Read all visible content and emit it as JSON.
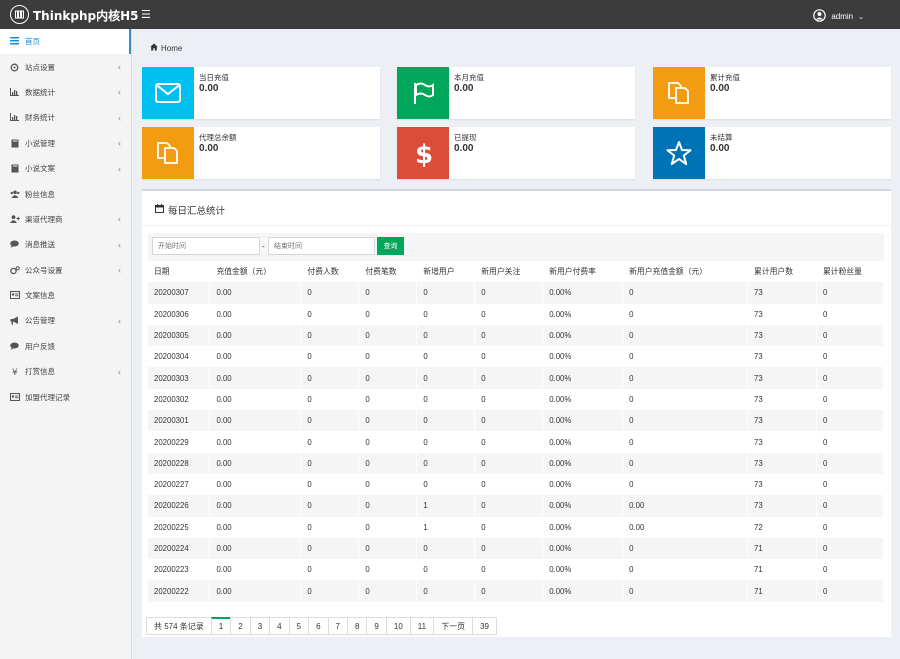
{
  "app": {
    "title": "Thinkphp内核H5",
    "user": "admin"
  },
  "sidebar": {
    "items": [
      {
        "label": "首页",
        "icon": "dashboard-icon",
        "chevron": false,
        "active": true
      },
      {
        "label": "站点设置",
        "icon": "settings-icon",
        "chevron": true
      },
      {
        "label": "数据统计",
        "icon": "bar-chart-icon",
        "chevron": true
      },
      {
        "label": "财务统计",
        "icon": "bar-chart-icon",
        "chevron": true
      },
      {
        "label": "小说管理",
        "icon": "book-icon",
        "chevron": true
      },
      {
        "label": "小说文案",
        "icon": "book-icon",
        "chevron": true
      },
      {
        "label": "粉丝信息",
        "icon": "users-icon",
        "chevron": false
      },
      {
        "label": "渠道代理商",
        "icon": "user-plus-icon",
        "chevron": true
      },
      {
        "label": "消息推送",
        "icon": "comments-icon",
        "chevron": true
      },
      {
        "label": "公众号设置",
        "icon": "cogs-icon",
        "chevron": true
      },
      {
        "label": "文案信息",
        "icon": "id-card-icon",
        "chevron": false
      },
      {
        "label": "公告管理",
        "icon": "bullhorn-icon",
        "chevron": true
      },
      {
        "label": "用户反馈",
        "icon": "comment-icon",
        "chevron": false
      },
      {
        "label": "打赏信息",
        "icon": "yen-icon",
        "chevron": true
      },
      {
        "label": "加盟代理记录",
        "icon": "id-card-icon",
        "chevron": false
      }
    ]
  },
  "breadcrumb": {
    "home": "Home"
  },
  "stats": [
    {
      "label": "当日充值",
      "value": "0.00",
      "color": "#00c0ef",
      "icon": "envelope-icon"
    },
    {
      "label": "本月充值",
      "value": "0.00",
      "color": "#00a65a",
      "icon": "flag-icon"
    },
    {
      "label": "累计充值",
      "value": "0.00",
      "color": "#f39c12",
      "icon": "copy-icon"
    },
    {
      "label": "代理总余额",
      "value": "0.00",
      "color": "#f39c12",
      "icon": "copy-icon"
    },
    {
      "label": "已提现",
      "value": "0.00",
      "color": "#dd4b39",
      "icon": "dollar-icon"
    },
    {
      "label": "未结算",
      "value": "0.00",
      "color": "#0073b7",
      "icon": "star-icon"
    }
  ],
  "panel": {
    "title": "每日汇总统计",
    "start_placeholder": "开始时间",
    "end_placeholder": "结束时间",
    "query_label": "查询"
  },
  "table": {
    "columns": [
      "日期",
      "充值金额（元）",
      "付费人数",
      "付费笔数",
      "新增用户",
      "新用户关注",
      "新用户付费率",
      "新用户充值金额（元）",
      "累计用户数",
      "累计粉丝量"
    ],
    "rows": [
      [
        "20200307",
        "0.00",
        "0",
        "0",
        "0",
        "0",
        "0.00%",
        "0",
        "73",
        "0"
      ],
      [
        "20200306",
        "0.00",
        "0",
        "0",
        "0",
        "0",
        "0.00%",
        "0",
        "73",
        "0"
      ],
      [
        "20200305",
        "0.00",
        "0",
        "0",
        "0",
        "0",
        "0.00%",
        "0",
        "73",
        "0"
      ],
      [
        "20200304",
        "0.00",
        "0",
        "0",
        "0",
        "0",
        "0.00%",
        "0",
        "73",
        "0"
      ],
      [
        "20200303",
        "0.00",
        "0",
        "0",
        "0",
        "0",
        "0.00%",
        "0",
        "73",
        "0"
      ],
      [
        "20200302",
        "0.00",
        "0",
        "0",
        "0",
        "0",
        "0.00%",
        "0",
        "73",
        "0"
      ],
      [
        "20200301",
        "0.00",
        "0",
        "0",
        "0",
        "0",
        "0.00%",
        "0",
        "73",
        "0"
      ],
      [
        "20200229",
        "0.00",
        "0",
        "0",
        "0",
        "0",
        "0.00%",
        "0",
        "73",
        "0"
      ],
      [
        "20200228",
        "0.00",
        "0",
        "0",
        "0",
        "0",
        "0.00%",
        "0",
        "73",
        "0"
      ],
      [
        "20200227",
        "0.00",
        "0",
        "0",
        "0",
        "0",
        "0.00%",
        "0",
        "73",
        "0"
      ],
      [
        "20200226",
        "0.00",
        "0",
        "0",
        "1",
        "0",
        "0.00%",
        "0.00",
        "73",
        "0"
      ],
      [
        "20200225",
        "0.00",
        "0",
        "0",
        "1",
        "0",
        "0.00%",
        "0.00",
        "72",
        "0"
      ],
      [
        "20200224",
        "0.00",
        "0",
        "0",
        "0",
        "0",
        "0.00%",
        "0",
        "71",
        "0"
      ],
      [
        "20200223",
        "0.00",
        "0",
        "0",
        "0",
        "0",
        "0.00%",
        "0",
        "71",
        "0"
      ],
      [
        "20200222",
        "0.00",
        "0",
        "0",
        "0",
        "0",
        "0.00%",
        "0",
        "71",
        "0"
      ]
    ]
  },
  "pagination": {
    "info": "共 574 条记录",
    "pages": [
      "1",
      "2",
      "3",
      "4",
      "5",
      "6",
      "7",
      "8",
      "9",
      "10",
      "11",
      "下一页",
      "39"
    ],
    "current": "1"
  }
}
